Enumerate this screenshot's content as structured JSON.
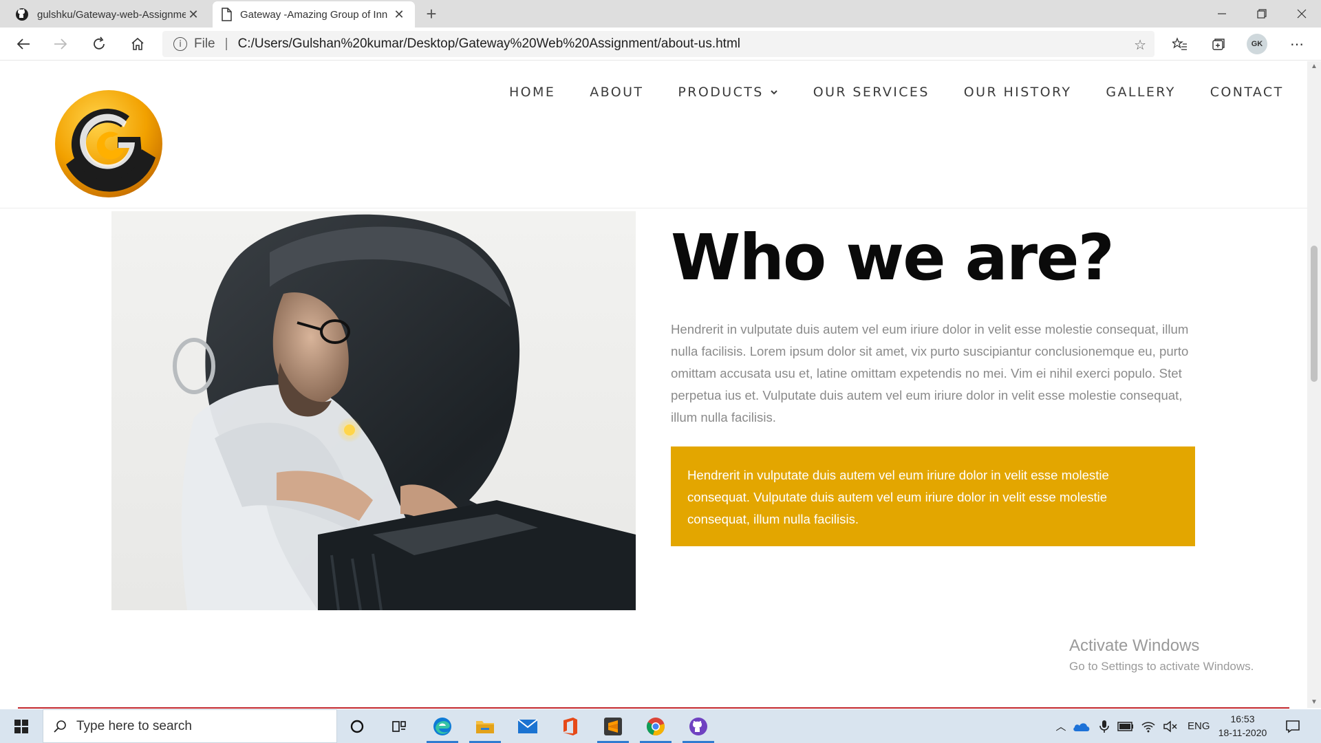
{
  "browser": {
    "tabs": [
      {
        "title": "gulshku/Gateway-web-Assignme",
        "icon": "github-icon",
        "active": false
      },
      {
        "title": "Gateway -Amazing Group of Inn",
        "icon": "page-icon",
        "active": true
      }
    ],
    "address": {
      "scheme_label": "File",
      "url": "C:/Users/Gulshan%20kumar/Desktop/Gateway%20Web%20Assignment/about-us.html"
    },
    "profile_initials": "GK"
  },
  "site": {
    "nav": [
      {
        "label": "HOME"
      },
      {
        "label": "ABOUT"
      },
      {
        "label": "PRODUCTS",
        "dropdown": true
      },
      {
        "label": "OUR SERVICES"
      },
      {
        "label": "OUR HISTORY"
      },
      {
        "label": "GALLERY"
      },
      {
        "label": "CONTACT"
      }
    ],
    "about": {
      "heading": "Who we are?",
      "paragraph": "Hendrerit in vulputate duis autem vel eum iriure dolor in velit esse molestie consequat, illum nulla facilisis. Lorem ipsum dolor sit amet, vix purto suscipiantur conclusionemque eu, purto omittam accusata usu et, latine omittam expetendis no mei. Vim ei nihil exerci populo. Stet perpetua ius et. Vulputate duis autem vel eum iriure dolor in velit esse molestie consequat, illum nulla facilisis.",
      "highlight": "Hendrerit in vulputate duis autem vel eum iriure dolor in velit esse molestie consequat. Vulputate duis autem vel eum iriure dolor in velit esse molestie consequat, illum nulla facilisis."
    },
    "colors": {
      "accent": "#e3a600",
      "heading": "#0a0a0a",
      "body_text": "#8a8a8a",
      "footer_line": "#c2272d"
    }
  },
  "watermark": {
    "title": "Activate Windows",
    "subtitle": "Go to Settings to activate Windows."
  },
  "taskbar": {
    "search_placeholder": "Type here to search",
    "apps": [
      "cortana-icon",
      "task-view-icon",
      "edge-icon",
      "file-explorer-icon",
      "mail-icon",
      "office-icon",
      "sublime-text-icon",
      "chrome-icon",
      "github-desktop-icon"
    ],
    "language": "ENG",
    "time": "16:53",
    "date": "18-11-2020"
  }
}
